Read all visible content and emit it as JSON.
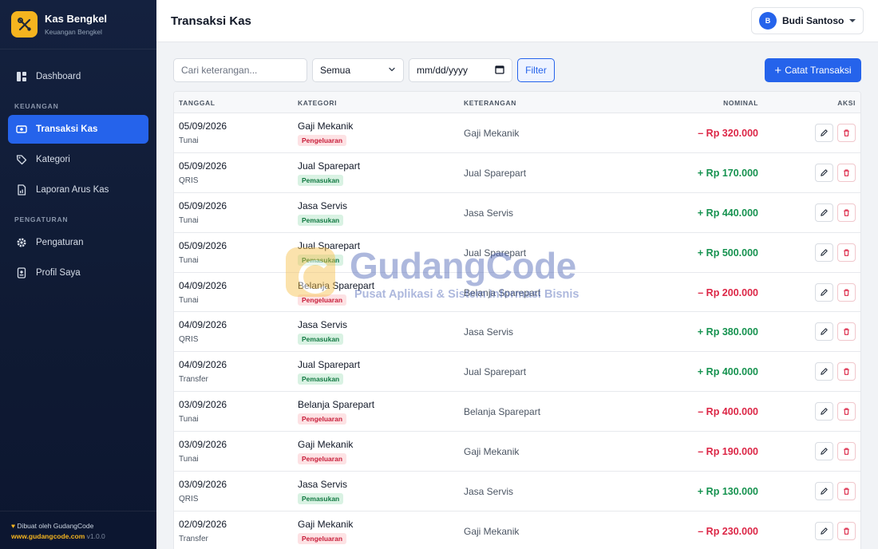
{
  "app": {
    "title": "Kas Bengkel",
    "subtitle": "Keuangan Bengkel"
  },
  "sidebar": {
    "dashboard": "Dashboard",
    "section_keuangan": "KEUANGAN",
    "transaksi_kas": "Transaksi Kas",
    "kategori": "Kategori",
    "laporan": "Laporan Arus Kas",
    "section_pengaturan": "PENGATURAN",
    "pengaturan": "Pengaturan",
    "profil": "Profil Saya",
    "footer_made": "Dibuat oleh GudangCode",
    "footer_link": "www.gudangcode.com",
    "footer_version": "v1.0.0"
  },
  "header": {
    "title": "Transaksi Kas",
    "user_initial": "B",
    "user_name": "Budi Santoso"
  },
  "filters": {
    "search_placeholder": "Cari keterangan...",
    "type_selected": "Semua",
    "date_placeholder": "mm/dd/yyyy",
    "filter_label": "Filter",
    "add_label": "Catat Transaksi"
  },
  "table": {
    "headers": {
      "date": "TANGGAL",
      "category": "KATEGORI",
      "description": "KETERANGAN",
      "amount": "NOMINAL",
      "actions": "AKSI"
    },
    "rows": [
      {
        "date": "05/09/2026",
        "method": "Tunai",
        "category": "Gaji Mekanik",
        "type": "Pengeluaran",
        "kind": "out",
        "description": "Gaji Mekanik",
        "amount": "– Rp 320.000"
      },
      {
        "date": "05/09/2026",
        "method": "QRIS",
        "category": "Jual Sparepart",
        "type": "Pemasukan",
        "kind": "in",
        "description": "Jual Sparepart",
        "amount": "+ Rp 170.000"
      },
      {
        "date": "05/09/2026",
        "method": "Tunai",
        "category": "Jasa Servis",
        "type": "Pemasukan",
        "kind": "in",
        "description": "Jasa Servis",
        "amount": "+ Rp 440.000"
      },
      {
        "date": "05/09/2026",
        "method": "Tunai",
        "category": "Jual Sparepart",
        "type": "Pemasukan",
        "kind": "in",
        "description": "Jual Sparepart",
        "amount": "+ Rp 500.000"
      },
      {
        "date": "04/09/2026",
        "method": "Tunai",
        "category": "Belanja Sparepart",
        "type": "Pengeluaran",
        "kind": "out",
        "description": "Belanja Sparepart",
        "amount": "– Rp 200.000"
      },
      {
        "date": "04/09/2026",
        "method": "QRIS",
        "category": "Jasa Servis",
        "type": "Pemasukan",
        "kind": "in",
        "description": "Jasa Servis",
        "amount": "+ Rp 380.000"
      },
      {
        "date": "04/09/2026",
        "method": "Transfer",
        "category": "Jual Sparepart",
        "type": "Pemasukan",
        "kind": "in",
        "description": "Jual Sparepart",
        "amount": "+ Rp 400.000"
      },
      {
        "date": "03/09/2026",
        "method": "Tunai",
        "category": "Belanja Sparepart",
        "type": "Pengeluaran",
        "kind": "out",
        "description": "Belanja Sparepart",
        "amount": "– Rp 400.000"
      },
      {
        "date": "03/09/2026",
        "method": "Tunai",
        "category": "Gaji Mekanik",
        "type": "Pengeluaran",
        "kind": "out",
        "description": "Gaji Mekanik",
        "amount": "– Rp 190.000"
      },
      {
        "date": "03/09/2026",
        "method": "QRIS",
        "category": "Jasa Servis",
        "type": "Pemasukan",
        "kind": "in",
        "description": "Jasa Servis",
        "amount": "+ Rp 130.000"
      },
      {
        "date": "02/09/2026",
        "method": "Transfer",
        "category": "Gaji Mekanik",
        "type": "Pengeluaran",
        "kind": "out",
        "description": "Gaji Mekanik",
        "amount": "– Rp 230.000"
      }
    ]
  },
  "watermark": {
    "title": "GudangCode",
    "subtitle": "Pusat Aplikasi & Sistem Informasi Bisnis"
  },
  "colors": {
    "primary": "#2563eb",
    "sidebar": "#14213f",
    "brand": "#f5b41f",
    "income": "#15924f",
    "expense": "#dc2646"
  }
}
